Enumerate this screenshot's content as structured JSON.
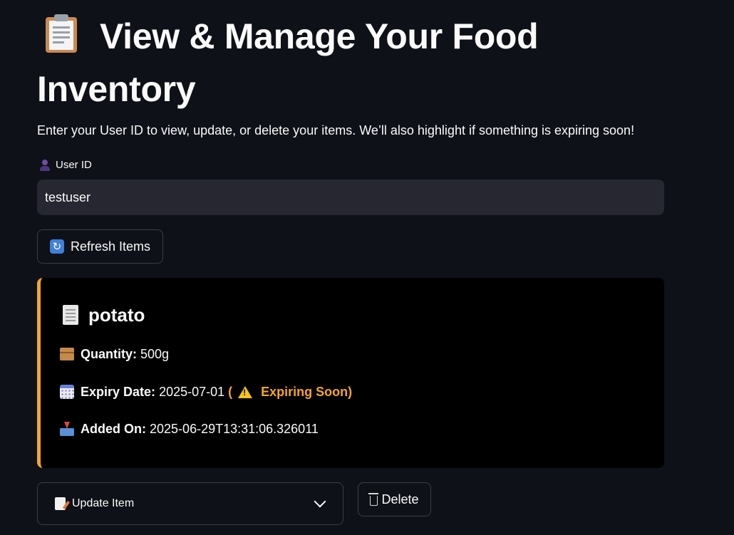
{
  "header": {
    "title_emoji": "📋",
    "title": "View & Manage Your Food Inventory",
    "subtitle": "Enter your User ID to view, update, or delete your items. We’ll also highlight if something is expiring soon!"
  },
  "user_field": {
    "label": "User ID",
    "value": "testuser"
  },
  "refresh_button": {
    "label": "Refresh Items"
  },
  "item": {
    "name": "potato",
    "quantity_label": "Quantity:",
    "quantity": "500g",
    "expiry_label": "Expiry Date:",
    "expiry_date": "2025-07-01",
    "expiry_open": "(",
    "expiry_status": "Expiring Soon)",
    "added_label": "Added On:",
    "added_on": "2025-06-29T13:31:06.326011",
    "accent_color": "#f5a623"
  },
  "actions": {
    "update_label": "Update Item",
    "delete_label": "Delete"
  }
}
